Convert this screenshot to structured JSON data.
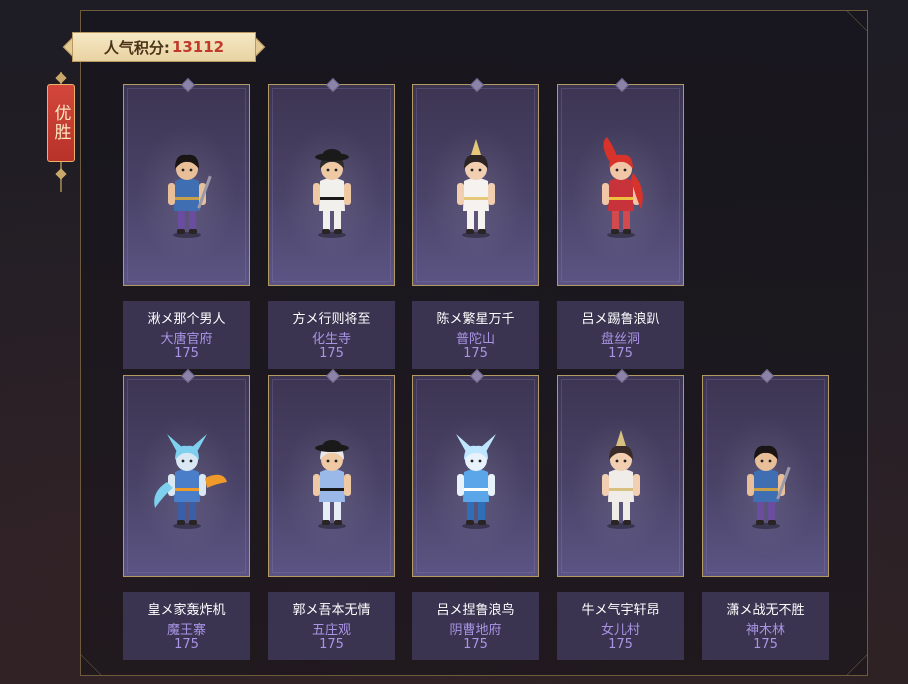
{
  "score": {
    "label": "人气积分:",
    "value": "13112"
  },
  "badge": {
    "label": "优胜"
  },
  "colors": {
    "accent": "#c0392b",
    "school_text": "#a994e6",
    "card_bg": "#3a3450",
    "border_gold": "#b39a63"
  },
  "players": [
    {
      "name": "湫メ那个男人",
      "school": "大唐官府",
      "points": "175",
      "avatar": "swordsman-character"
    },
    {
      "name": "方メ行则将至",
      "school": "化生寺",
      "points": "175",
      "avatar": "monk-character"
    },
    {
      "name": "陈メ繁星万千",
      "school": "普陀山",
      "points": "175",
      "avatar": "fairy-girl-character"
    },
    {
      "name": "吕メ踢鲁浪趴",
      "school": "盘丝洞",
      "points": "175",
      "avatar": "red-hair-girl-character"
    },
    {
      "name": "皇メ家轰炸机",
      "school": "魔王寨",
      "points": "175",
      "avatar": "blue-demon-character"
    },
    {
      "name": "郭メ吾本无情",
      "school": "五庄观",
      "points": "175",
      "avatar": "straw-hat-boy-character"
    },
    {
      "name": "吕メ捏鲁浪鸟",
      "school": "阴曹地府",
      "points": "175",
      "avatar": "ice-warrior-character"
    },
    {
      "name": "牛メ气宇轩昂",
      "school": "女儿村",
      "points": "175",
      "avatar": "dancer-girl-character"
    },
    {
      "name": "潇メ战无不胜",
      "school": "神木林",
      "points": "175",
      "avatar": "swordsman-character"
    }
  ]
}
